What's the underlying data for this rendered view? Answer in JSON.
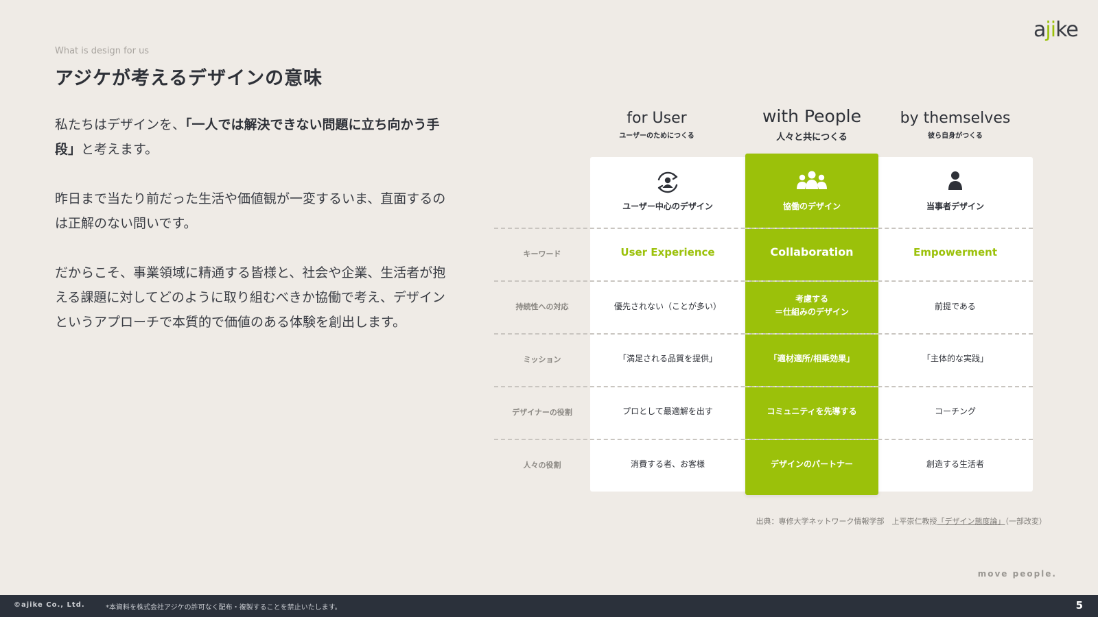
{
  "brand": {
    "logo_a": "a",
    "logo_ji": "ji",
    "logo_ke": "ke",
    "accent": "#9bc10a"
  },
  "header": {
    "eyebrow": "What is design for us",
    "title": "アジケが考えるデザインの意味"
  },
  "body": {
    "p1_pre": " 私たちはデザインを、",
    "p1_bold": "「一人では解決できない問題に立ち向かう手段」",
    "p1_post": "と考えます。",
    "p2": " 昨日まで当たり前だった生活や価値観が一変するいま、直面するのは正解のない問いです。",
    "p3": "だからこそ、事業領域に精通する皆様と、社会や企業、生活者が抱える課題に対してどのように取り組むべきか協働で考え、デザインというアプローチで本質的で価値のある体験を創出します。"
  },
  "table": {
    "columns": [
      {
        "title": "for User",
        "subtitle": "ユーザーのためにつくる",
        "icon": "user-cycle-icon",
        "icon_label": "ユーザー中心のデザイン"
      },
      {
        "title": "with People",
        "subtitle": "人々と共につくる",
        "icon": "group-icon",
        "icon_label": "協働のデザイン"
      },
      {
        "title": "by themselves",
        "subtitle": "彼ら自身がつくる",
        "icon": "person-icon",
        "icon_label": "当事者デザイン"
      }
    ],
    "rows": [
      {
        "label": "キーワード",
        "cells": [
          "User Experience",
          "Collaboration",
          "Empowerment"
        ]
      },
      {
        "label": "持続性への対応",
        "cells": [
          "優先されない（ことが多い）",
          "考慮する\n＝仕組みのデザイン",
          "前提である"
        ]
      },
      {
        "label": "ミッション",
        "cells": [
          "「満足される品質を提供」",
          "「適材適所/相乗効果」",
          "「主体的な実践」"
        ]
      },
      {
        "label": "デザイナーの役割",
        "cells": [
          "プロとして最適解を出す",
          "コミュニティを先導する",
          "コーチング"
        ]
      },
      {
        "label": "人々の役割",
        "cells": [
          "消費する者、お客様",
          "デザインのパートナー",
          "創造する生活者"
        ]
      }
    ]
  },
  "source": {
    "prefix": "出典：専修大学ネットワーク情報学部　上平崇仁教授",
    "link": "「デザイン態度論」",
    "suffix": "（一部改変）"
  },
  "tagline": "move people.",
  "footer": {
    "copyright": "©ajike Co., Ltd.",
    "note": "*本資料を株式会社アジケの許可なく配布・複製することを禁止いたします。",
    "page": "5"
  }
}
